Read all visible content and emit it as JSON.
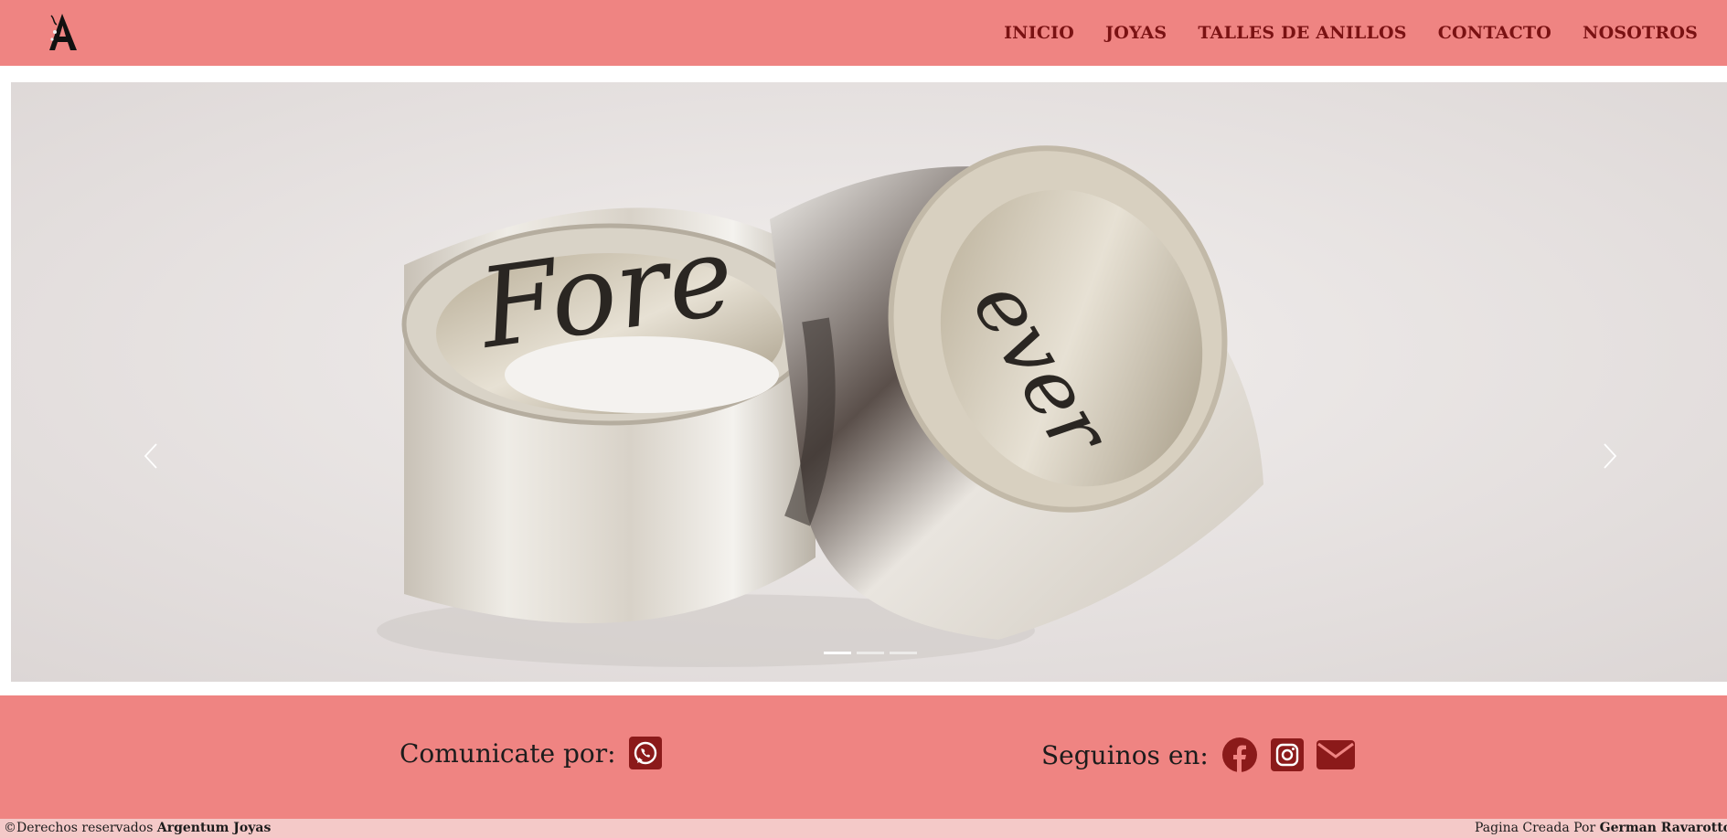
{
  "brand": {
    "logo_icon": "argentum-a-logo-icon",
    "colors": {
      "nav_bg": "#ef8482",
      "nav_text": "#7a1213",
      "icon": "#8b1a1a",
      "footer_bg": "#f4c9c8"
    }
  },
  "nav": {
    "items": [
      {
        "label": "INICIO"
      },
      {
        "label": "JOYAS"
      },
      {
        "label": "TALLES DE ANILLOS"
      },
      {
        "label": "CONTACTO"
      },
      {
        "label": "NOSOTROS"
      }
    ]
  },
  "carousel": {
    "slides_total": 3,
    "active_slide": 1,
    "prev_icon": "chevron-left-icon",
    "next_icon": "chevron-right-icon"
  },
  "contact": {
    "communicate_label": "Comunicate por:",
    "communicate_icons": [
      "whatsapp-icon"
    ],
    "follow_label": "Seguinos en:",
    "follow_icons": [
      "facebook-icon",
      "instagram-icon",
      "email-icon"
    ]
  },
  "footer": {
    "rights_prefix": "©Derechos reservados",
    "rights_brand": "Argentum Joyas",
    "credit_prefix": "Pagina Creada Por",
    "credit_name": "German Ravarotto"
  }
}
